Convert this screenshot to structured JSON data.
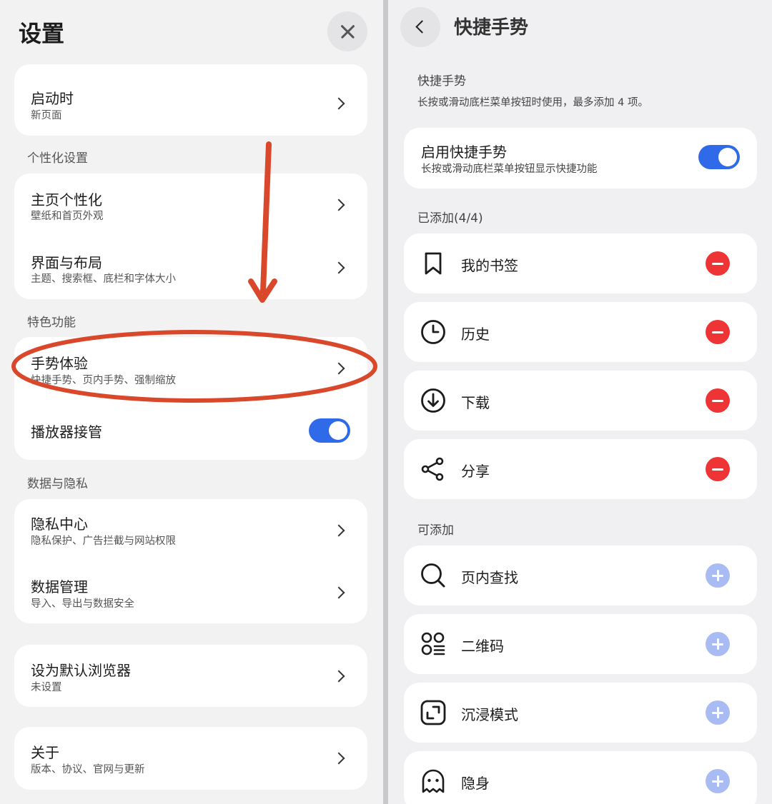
{
  "left": {
    "title": "设置",
    "items": {
      "startup": {
        "title": "启动时",
        "subtitle": "新页面"
      },
      "home": {
        "title": "主页个性化",
        "subtitle": "壁纸和首页外观"
      },
      "layout": {
        "title": "界面与布局",
        "subtitle": "主题、搜索框、底栏和字体大小"
      },
      "gesture": {
        "title": "手势体验",
        "subtitle": "快捷手势、页内手势、强制缩放"
      },
      "player": {
        "title": "播放器接管",
        "toggle_on": true
      },
      "privacy": {
        "title": "隐私中心",
        "subtitle": "隐私保护、广告拦截与网站权限"
      },
      "data": {
        "title": "数据管理",
        "subtitle": "导入、导出与数据安全"
      },
      "default_browser": {
        "title": "设为默认浏览器",
        "subtitle": "未设置"
      },
      "about": {
        "title": "关于",
        "subtitle": "版本、协议、官网与更新"
      }
    },
    "sections": {
      "personal": "个性化设置",
      "features": "特色功能",
      "privacy": "数据与隐私"
    },
    "annotation_color": "#d9482b"
  },
  "right": {
    "title": "快捷手势",
    "header_label": "快捷手势",
    "header_desc": "长按或滑动底栏菜单按钮时使用，最多添加 4 项。",
    "enable": {
      "title": "启用快捷手势",
      "subtitle": "长按或滑动底栏菜单按钮显示快捷功能",
      "toggle_on": true
    },
    "added_label": "已添加(4/4)",
    "added": [
      {
        "name": "我的书签",
        "icon": "bookmark-icon"
      },
      {
        "name": "历史",
        "icon": "clock-icon"
      },
      {
        "name": "下载",
        "icon": "download-icon"
      },
      {
        "name": "分享",
        "icon": "share-icon"
      }
    ],
    "available_label": "可添加",
    "available": [
      {
        "name": "页内查找",
        "icon": "search-icon"
      },
      {
        "name": "二维码",
        "icon": "qrcode-icon"
      },
      {
        "name": "沉浸模式",
        "icon": "immersive-icon"
      },
      {
        "name": "隐身",
        "icon": "ghost-icon"
      }
    ],
    "colors": {
      "remove": "#ee3434",
      "add": "#a9bbf3",
      "toggle": "#2f6be8"
    }
  }
}
